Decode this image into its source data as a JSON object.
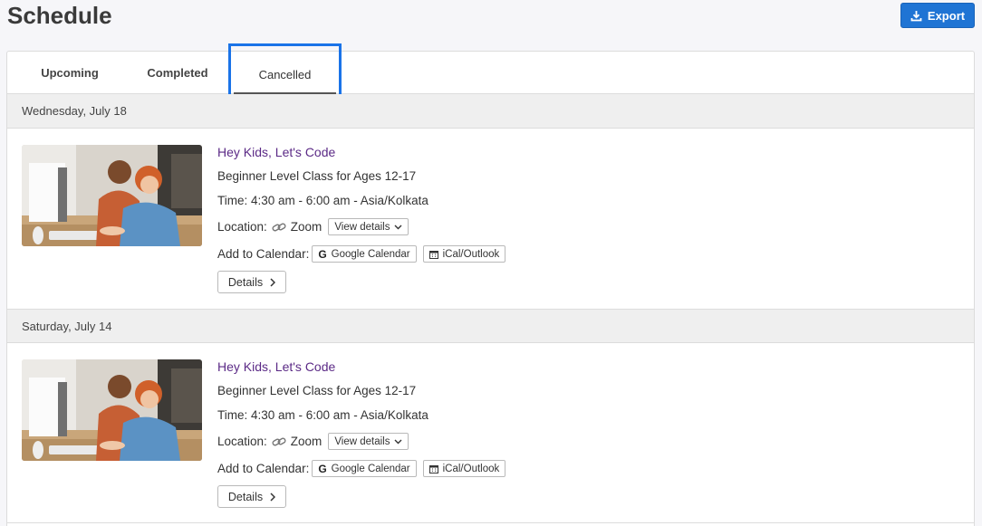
{
  "page": {
    "title": "Schedule"
  },
  "header": {
    "export_label": "Export"
  },
  "tabs": [
    {
      "label": "Upcoming"
    },
    {
      "label": "Completed"
    },
    {
      "label": "Cancelled"
    }
  ],
  "days": [
    {
      "date": "Wednesday, July 18",
      "event": {
        "title": "Hey Kids, Let's Code",
        "subtitle": "Beginner Level Class for Ages 12-17",
        "time": "Time: 4:30 am - 6:00 am - Asia/Kolkata",
        "location_label": "Location:",
        "location_value": "Zoom",
        "view_details_label": "View details",
        "calendar_label": "Add to Calendar:",
        "google_calendar_label": "Google Calendar",
        "ical_label": "iCal/Outlook",
        "details_label": "Details"
      }
    },
    {
      "date": "Saturday, July 14",
      "event": {
        "title": "Hey Kids, Let's Code",
        "subtitle": "Beginner Level Class for Ages 12-17",
        "time": "Time: 4:30 am - 6:00 am - Asia/Kolkata",
        "location_label": "Location:",
        "location_value": "Zoom",
        "view_details_label": "View details",
        "calendar_label": "Add to Calendar:",
        "google_calendar_label": "Google Calendar",
        "ical_label": "iCal/Outlook",
        "details_label": "Details"
      }
    }
  ],
  "icons": {
    "export": "download-icon",
    "location": "link-icon",
    "view_details": "chevron-down-icon",
    "google": "google-icon",
    "ical": "calendar-icon",
    "details": "chevron-right-icon"
  },
  "colors": {
    "accent": "#1f74d4",
    "event_title": "#5b2a86",
    "tab_highlight": "#1a73e8"
  }
}
